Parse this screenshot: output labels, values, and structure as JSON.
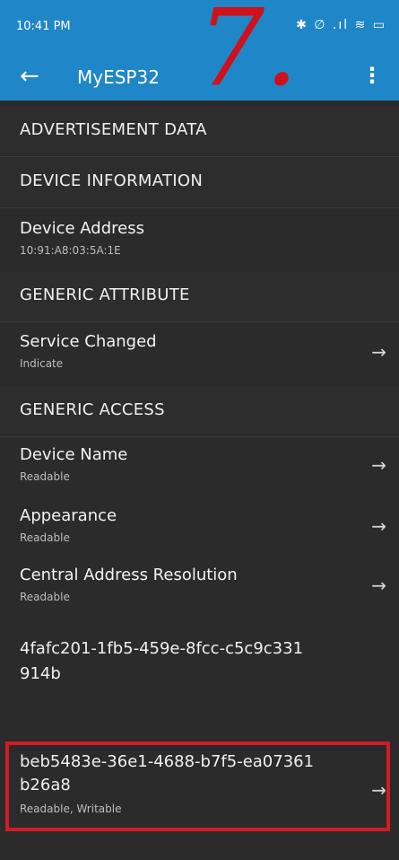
{
  "status_bar": {
    "time": "10:41 PM",
    "icons": "✱ ∅ .ıl ≋ ▭"
  },
  "app_bar": {
    "title": "MyESP32",
    "back_icon": "←",
    "menu_icon": "⋮"
  },
  "overlay": {
    "number": "7."
  },
  "sections": {
    "advertisement": "ADVERTISEMENT DATA",
    "device_info": "DEVICE INFORMATION",
    "generic_attribute": "GENERIC ATTRIBUTE",
    "generic_access": "GENERIC ACCESS"
  },
  "items": {
    "device_address": {
      "title": "Device Address",
      "sub": "10:91:A8:03:5A:1E"
    },
    "service_changed": {
      "title": "Service Changed",
      "sub": "Indicate"
    },
    "device_name": {
      "title": "Device Name",
      "sub": "Readable"
    },
    "appearance": {
      "title": "Appearance",
      "sub": "Readable"
    },
    "central_address_resolution": {
      "title": "Central Address Resolution",
      "sub": "Readable"
    }
  },
  "custom_service": {
    "uuid_line1": "4fafc201-1fb5-459e-8fcc-c5c9c331",
    "uuid_line2": "914b"
  },
  "custom_characteristic": {
    "uuid_line1": "beb5483e-36e1-4688-b7f5-ea07361",
    "uuid_line2": "b26a8",
    "sub": "Readable, Writable"
  },
  "arrow_glyph": "→",
  "colors": {
    "accent": "#1f86c7",
    "highlight": "#d41a24",
    "background": "#2b2b2b"
  }
}
